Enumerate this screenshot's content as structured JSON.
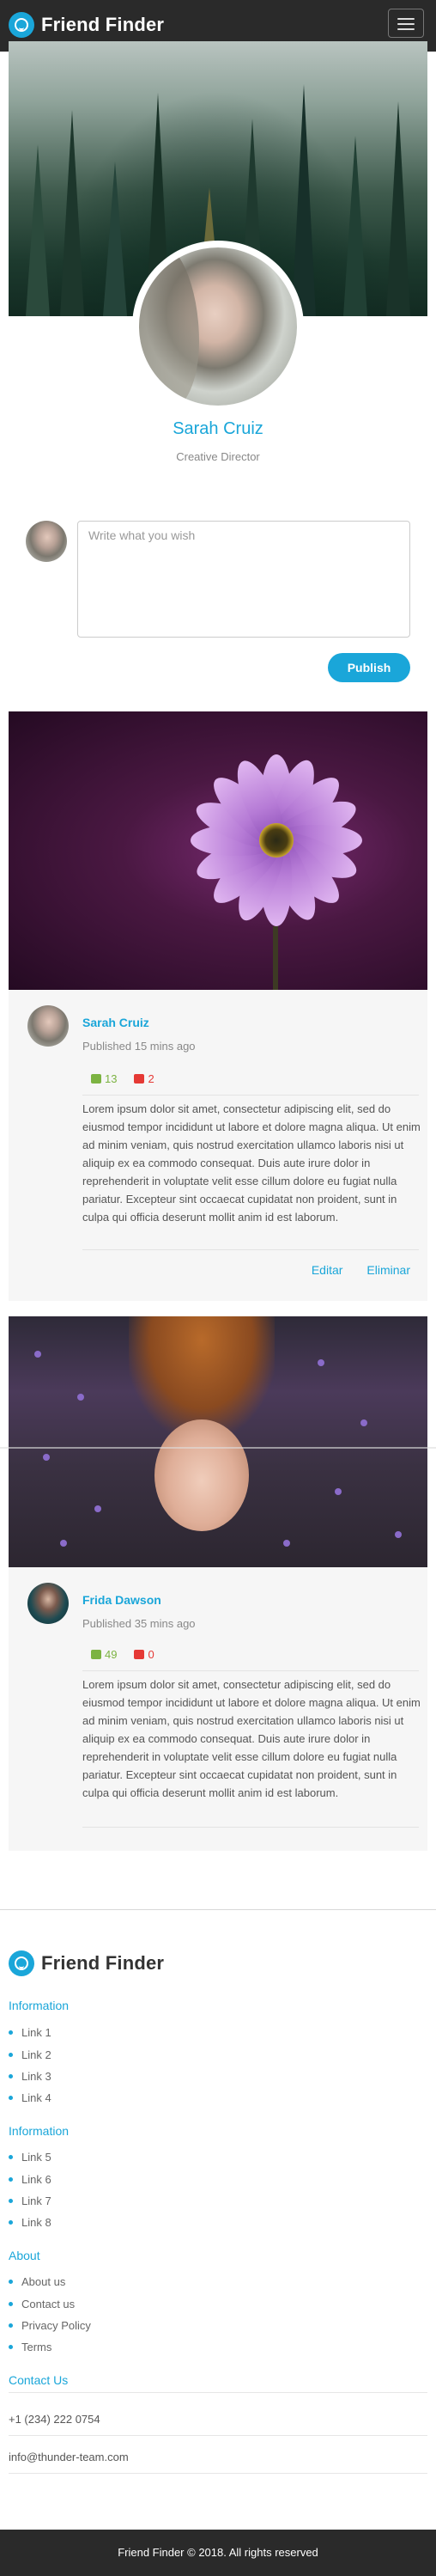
{
  "navbar": {
    "brand": "Friend Finder",
    "menu_icon": "hamburger-menu-icon"
  },
  "profile": {
    "name": "Sarah Cruiz",
    "role": "Creative Director"
  },
  "post_form": {
    "placeholder": "Write what you wish",
    "publish_label": "Publish"
  },
  "posts": [
    {
      "author": "Sarah Cruiz",
      "published": "Published 15 mins ago",
      "likes": "13",
      "dislikes": "2",
      "text": "Lorem ipsum dolor sit amet, consectetur adipiscing elit, sed do eiusmod tempor incididunt ut labore et dolore magna aliqua. Ut enim ad minim veniam, quis nostrud exercitation ullamco laboris nisi ut aliquip ex ea commodo consequat. Duis aute irure dolor in reprehenderit in voluptate velit esse cillum dolore eu fugiat nulla pariatur. Excepteur sint occaecat cupidatat non proident, sunt in culpa qui officia deserunt mollit anim id est laborum.",
      "edit_label": "Editar",
      "delete_label": "Eliminar"
    },
    {
      "author": "Frida Dawson",
      "published": "Published 35 mins ago",
      "likes": "49",
      "dislikes": "0",
      "text": "Lorem ipsum dolor sit amet, consectetur adipiscing elit, sed do eiusmod tempor incididunt ut labore et dolore magna aliqua. Ut enim ad minim veniam, quis nostrud exercitation ullamco laboris nisi ut aliquip ex ea commodo consequat. Duis aute irure dolor in reprehenderit in voluptate velit esse cillum dolore eu fugiat nulla pariatur. Excepteur sint occaecat cupidatat non proident, sunt in culpa qui officia deserunt mollit anim id est laborum."
    }
  ],
  "footer": {
    "brand": "Friend Finder",
    "sections": [
      {
        "title": "Information",
        "links": [
          "Link 1",
          "Link 2",
          "Link 3",
          "Link 4"
        ]
      },
      {
        "title": "Information",
        "links": [
          "Link 5",
          "Link 6",
          "Link 7",
          "Link 8"
        ]
      },
      {
        "title": "About",
        "links": [
          "About us",
          "Contact us",
          "Privacy Policy",
          "Terms"
        ]
      }
    ],
    "contact_title": "Contact Us",
    "phone": "+1 (234) 222 0754",
    "email": "info@thunder-team.com",
    "copyright": "Friend Finder © 2018. All rights reserved"
  },
  "colors": {
    "accent": "#1aa6d9",
    "navbar": "#2a2a2a",
    "like": "#7cb342",
    "dislike": "#e53935"
  }
}
